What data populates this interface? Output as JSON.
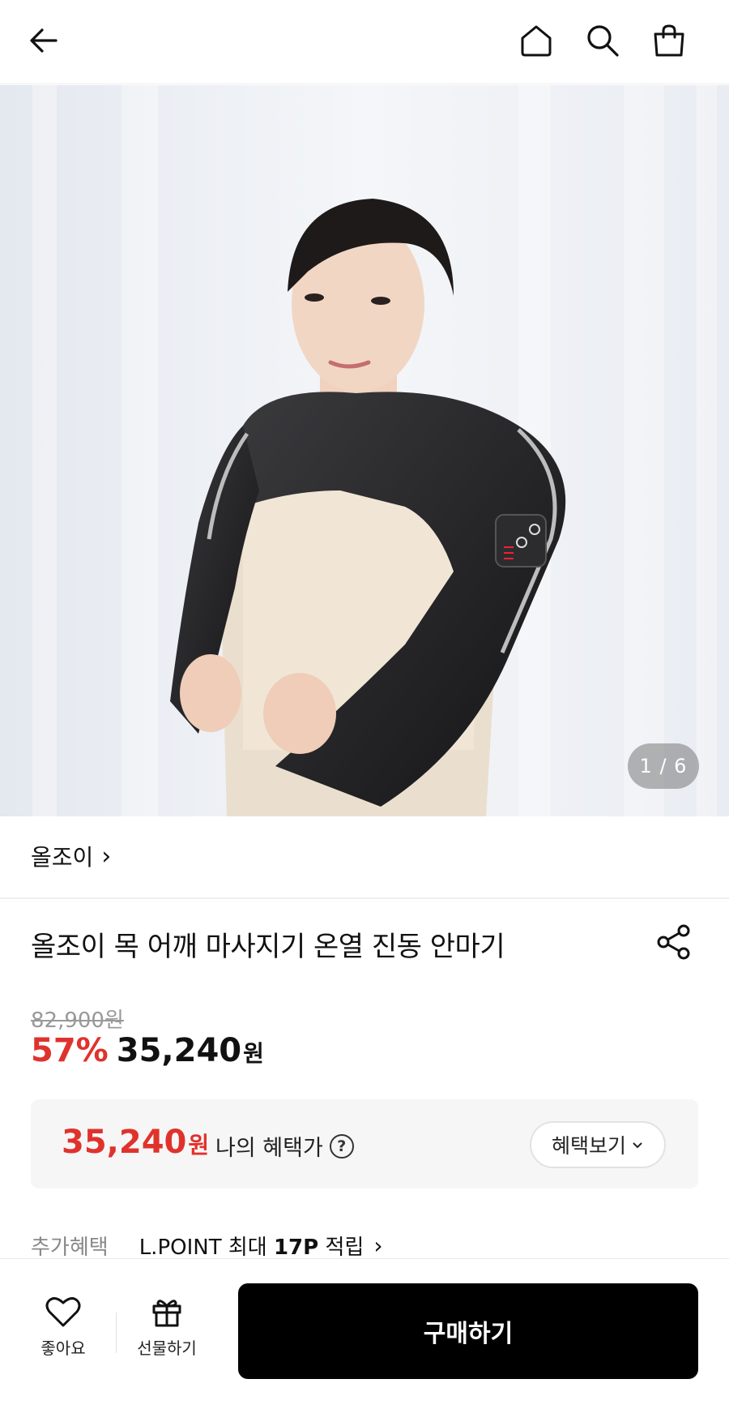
{
  "header": {
    "back_icon": "arrow-left-icon",
    "home_icon": "home-icon",
    "search_icon": "search-icon",
    "cart_icon": "shopping-bag-icon"
  },
  "hero": {
    "image_alt": "product-photo",
    "counter": "1 / 6"
  },
  "brand": {
    "name": "올조이",
    "chevron": "›"
  },
  "product": {
    "title": "올조이 목 어깨 마사지기 온열 진동 안마기",
    "share_icon": "share-icon"
  },
  "price": {
    "original": "82,900원",
    "discount": "57%",
    "sale": "35,240",
    "unit": "원"
  },
  "benefit": {
    "price": "35,240",
    "unit": "원",
    "label": "나의 혜택가",
    "help": "?",
    "button": "혜택보기",
    "button_chevron": "⌄"
  },
  "extra": {
    "label": "추가혜택",
    "text_prefix": "L.POINT 최대 ",
    "text_bold": "17P",
    "text_suffix": " 적립",
    "chevron": "›"
  },
  "bottom": {
    "like_label": "좋아요",
    "gift_label": "선물하기",
    "buy_label": "구매하기"
  },
  "colors": {
    "accent_red": "#e0322c",
    "buy_button": "#000000",
    "benefit_bg": "#f6f6f6"
  }
}
